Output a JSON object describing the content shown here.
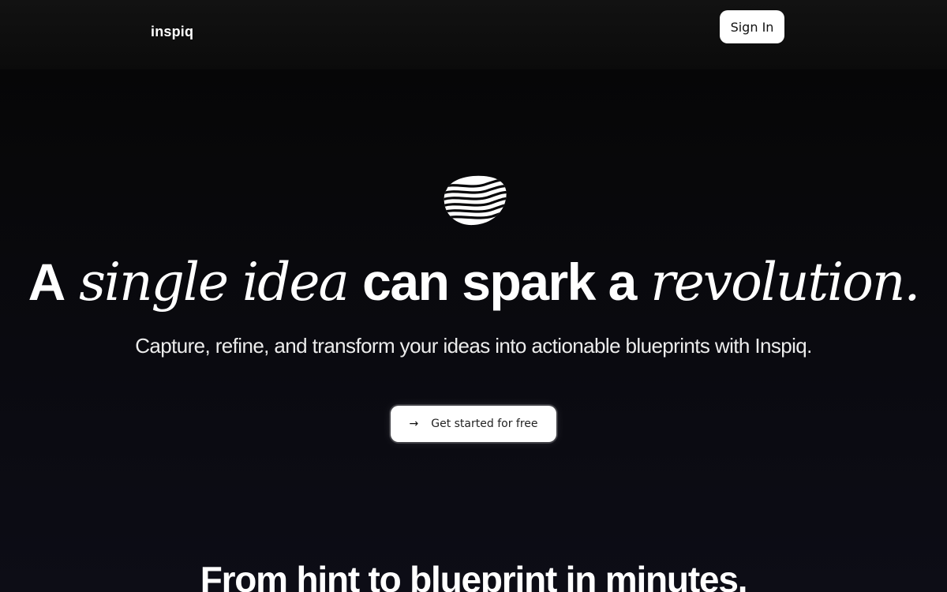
{
  "header": {
    "brand": "inspiq",
    "signin_label": "Sign In"
  },
  "hero": {
    "logo_icon": "wave-stack-icon",
    "headline": {
      "part1": "A",
      "part2": "single idea",
      "part3": "can spark a",
      "part4": "revolution."
    },
    "subtitle": "Capture, refine, and transform your ideas into actionable blueprints with Inspiq.",
    "cta_label": "Get started for free",
    "cta_icon": "arrow-right-icon"
  },
  "section": {
    "title": "From hint to blueprint in minutes."
  },
  "colors": {
    "background": "#050505",
    "button_bg": "#ffffff",
    "button_text": "#111111",
    "text": "#ffffff"
  }
}
